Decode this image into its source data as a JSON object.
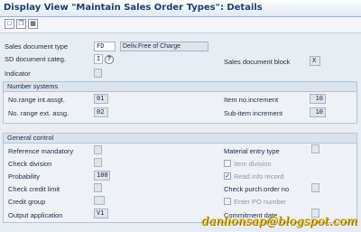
{
  "window": {
    "title": "Display View \"Maintain Sales Order Types\": Details"
  },
  "toolbar": {
    "icons": [
      "new-entries-icon",
      "copy-icon",
      "delete-icon"
    ]
  },
  "header": {
    "sales_doc_type_label": "Sales document type",
    "sales_doc_type_value": "FD",
    "sales_doc_type_desc": "Deliv.Free of Charge",
    "sd_doc_categ_label": "SD document categ.",
    "sd_doc_categ_value": "I",
    "indicator_label": "Indicator",
    "sales_doc_block_label": "Sales document block",
    "sales_doc_block_value": "X"
  },
  "number_systems": {
    "title": "Number systems",
    "int_assgt_label": "No.range int.assgt.",
    "int_assgt_value": "01",
    "ext_assg_label": "No. range ext. assg.",
    "ext_assg_value": "02",
    "item_incr_label": "Item no.increment",
    "item_incr_value": "10",
    "subitem_incr_label": "Sub-item increment",
    "subitem_incr_value": "10"
  },
  "general_control": {
    "title": "General control",
    "reference_mandatory_label": "Reference mandatory",
    "check_division_label": "Check division",
    "probability_label": "Probability",
    "probability_value": "100",
    "check_credit_limit_label": "Check credit limit",
    "credit_group_label": "Credit group",
    "output_application_label": "Output application",
    "output_application_value": "V1",
    "material_entry_type_label": "Material entry type",
    "item_division_label": "Item division",
    "item_division_checked": false,
    "read_info_record_label": "Read info record",
    "read_info_record_checked": true,
    "check_purch_order_label": "Check purch.order no",
    "enter_po_number_label": "Enter PO number",
    "enter_po_number_checked": false,
    "commitment_date_label": "Commitment  date"
  },
  "watermark": {
    "text": "danlionsap@blogspot.com"
  }
}
